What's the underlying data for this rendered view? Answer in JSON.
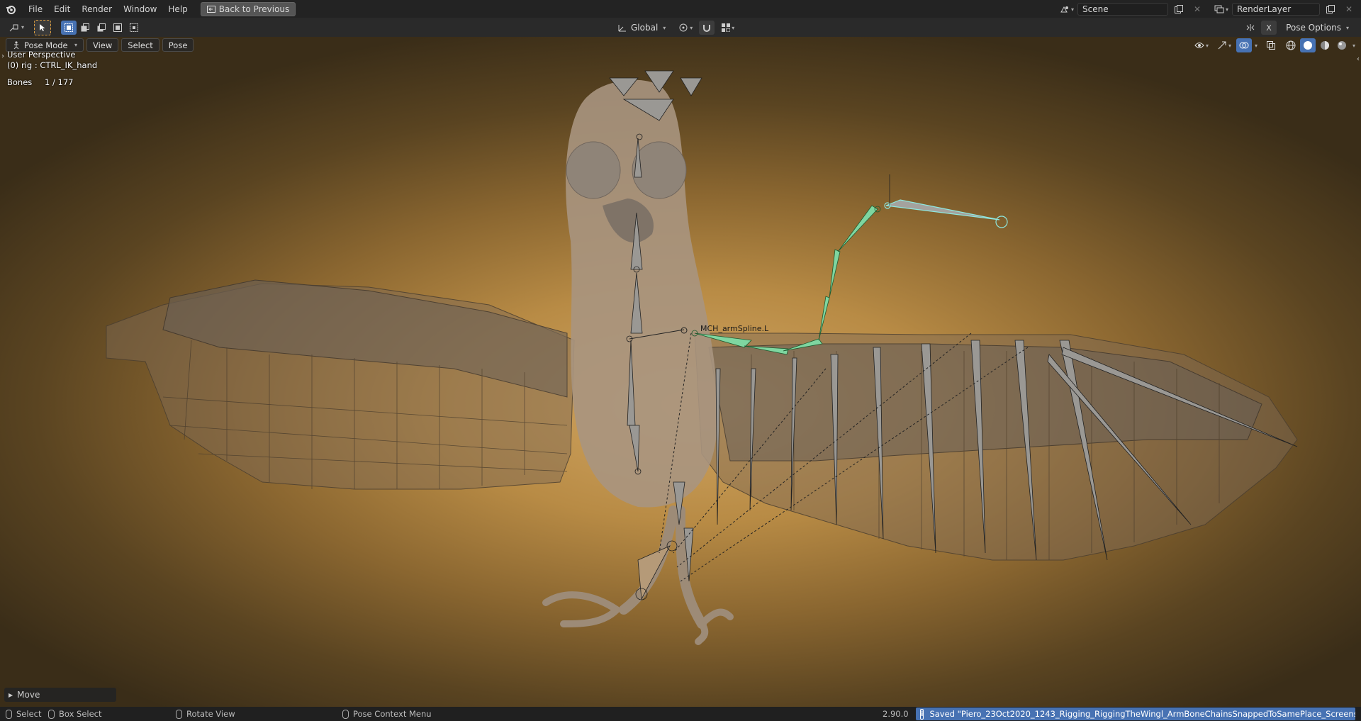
{
  "topbar": {
    "menus": [
      "File",
      "Edit",
      "Render",
      "Window",
      "Help"
    ],
    "back_button": "Back to Previous",
    "scene_name": "Scene",
    "view_layer": "RenderLayer"
  },
  "toolbar": {
    "transform_orientation": "Global",
    "pose_options": "Pose Options",
    "x_mirror": "X"
  },
  "viewport": {
    "mode": "Pose Mode",
    "menus": [
      "View",
      "Select",
      "Pose"
    ],
    "perspective": "User Perspective",
    "active_object": "(0) rig : CTRL_IK_hand",
    "stats_label": "Bones",
    "stats_value": "1 / 177",
    "bone_label": "MCH_armSpline.L",
    "operator_panel": "Move"
  },
  "statusbar": {
    "select": "Select",
    "box_select": "Box Select",
    "rotate_view": "Rotate View",
    "context_menu": "Pose Context Menu",
    "version": "2.90.0",
    "message": "Saved \"Piero_23Oct2020_1243_Rigging_RiggingTheWingl_ArmBoneChainsSnappedToSamePlace_Screenshot.blend\""
  },
  "colors": {
    "accent": "#4772b3",
    "selected_bone": "#7fd6a0",
    "active_bone": "#8ee8e0",
    "viewport_center": "#d2a662",
    "viewport_edge": "#3a2d18"
  }
}
